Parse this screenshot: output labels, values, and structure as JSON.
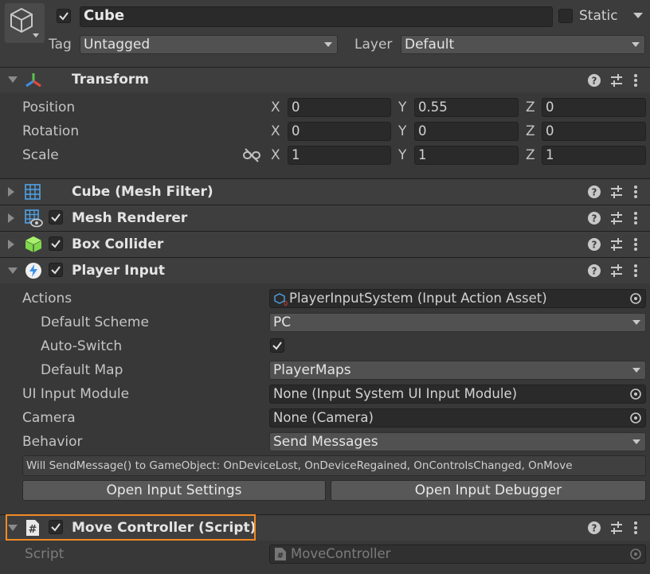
{
  "object": {
    "name": "Cube",
    "static_label": "Static",
    "tag_label": "Tag",
    "tag_value": "Untagged",
    "layer_label": "Layer",
    "layer_value": "Default"
  },
  "transform": {
    "title": "Transform",
    "rows": [
      {
        "label": "Position",
        "x": "0",
        "y": "0.55",
        "z": "0"
      },
      {
        "label": "Rotation",
        "x": "0",
        "y": "0",
        "z": "0"
      },
      {
        "label": "Scale",
        "x": "1",
        "y": "1",
        "z": "1"
      }
    ],
    "axis_x": "X",
    "axis_y": "Y",
    "axis_z": "Z"
  },
  "components": {
    "mesh_filter": "Cube (Mesh Filter)",
    "mesh_renderer": "Mesh Renderer",
    "box_collider": "Box Collider",
    "player_input": "Player Input",
    "move_controller": "Move Controller (Script)"
  },
  "player_input": {
    "actions_label": "Actions",
    "actions_value": "PlayerInputSystem (Input Action Asset)",
    "default_scheme_label": "Default Scheme",
    "default_scheme_value": "PC",
    "auto_switch_label": "Auto-Switch",
    "default_map_label": "Default Map",
    "default_map_value": "PlayerMaps",
    "ui_input_module_label": "UI Input Module",
    "ui_input_module_value": "None (Input System UI Input Module)",
    "camera_label": "Camera",
    "camera_value": "None (Camera)",
    "behavior_label": "Behavior",
    "behavior_value": "Send Messages",
    "info_text": "Will SendMessage() to GameObject: OnDeviceLost, OnDeviceRegained, OnControlsChanged, OnMove",
    "open_settings_button": "Open Input Settings",
    "open_debugger_button": "Open Input Debugger"
  },
  "move_controller": {
    "script_label": "Script",
    "script_value": "MoveController"
  },
  "colors": {
    "background": "#383838",
    "highlight": "#f08a24",
    "field": "#2a2a2a"
  }
}
